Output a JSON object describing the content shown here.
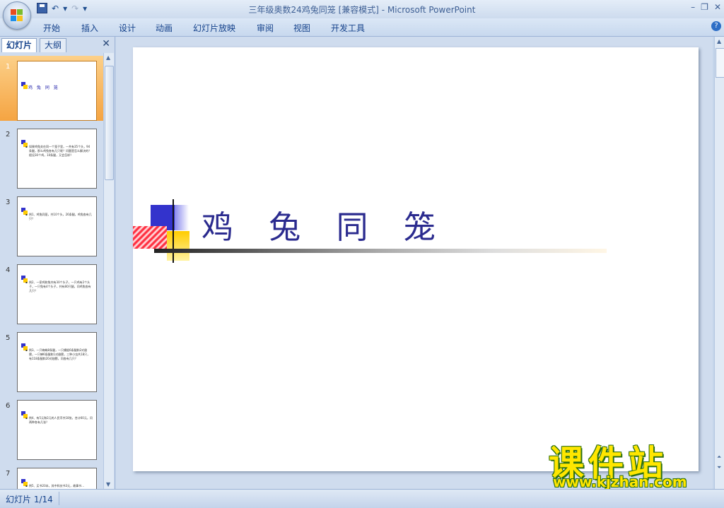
{
  "window": {
    "title": "三年级奥数24鸡兔同笼 [兼容模式] - Microsoft PowerPoint",
    "minimize": "–",
    "restore": "❐",
    "close": "✕"
  },
  "quick_access": {
    "save_icon": "save-icon",
    "undo_glyph": "↶",
    "dropdown_glyph": "▾",
    "redo_glyph": "↷",
    "customize_glyph": "▾"
  },
  "ribbon_tabs": [
    "开始",
    "插入",
    "设计",
    "动画",
    "幻灯片放映",
    "审阅",
    "视图",
    "开发工具"
  ],
  "help_glyph": "?",
  "panel": {
    "tabs": [
      "幻灯片",
      "大纲"
    ],
    "close_glyph": "✕",
    "thumbnails": [
      {
        "num": "1",
        "title": "鸡 兔 同 笼",
        "text": ""
      },
      {
        "num": "2",
        "text": "如果鸡兔关在同一个笼子里，一共有35个头，94条腿，那么鸡兔各有几只呢？问题是怎么解决的？假设30个鸡，10条腿，又会怎样？"
      },
      {
        "num": "3",
        "text": "例1、鸡兔同笼，共10个头，26条腿，鸡兔各有几只？"
      },
      {
        "num": "4",
        "text": "例2、一家鸡和兔共有30个头子，一只鸡有2个头子，一只兔有4个头子，共有80只腿，问鸡兔各有几只？"
      },
      {
        "num": "5",
        "text": "例3、一只蜘蛛8条腿，一只蜻蜓6条腿和2对翅膀，一只蝉6条腿和1对翅膀，三种小虫共18只，有118条腿和20对翅膀，问各有几只？"
      },
      {
        "num": "6",
        "text": "例4、有5元和2元的人民币共18张，合计60元，问两种各有几张？"
      },
      {
        "num": "7",
        "text": "例5、买书20本，其中科技书3元，故事书..."
      }
    ]
  },
  "slide": {
    "title": "鸡 兔 同 笼"
  },
  "status": {
    "slide_indicator": "幻灯片 1/14"
  },
  "watermark": {
    "brand": "课件站",
    "url": "www.kjzhan.com"
  },
  "colors": {
    "accent_orange": "#f5a442",
    "slide_title": "#2b2b8f",
    "logo_blue": "#3333cc",
    "logo_yellow": "#ffcc00",
    "logo_red": "#ff3344"
  }
}
